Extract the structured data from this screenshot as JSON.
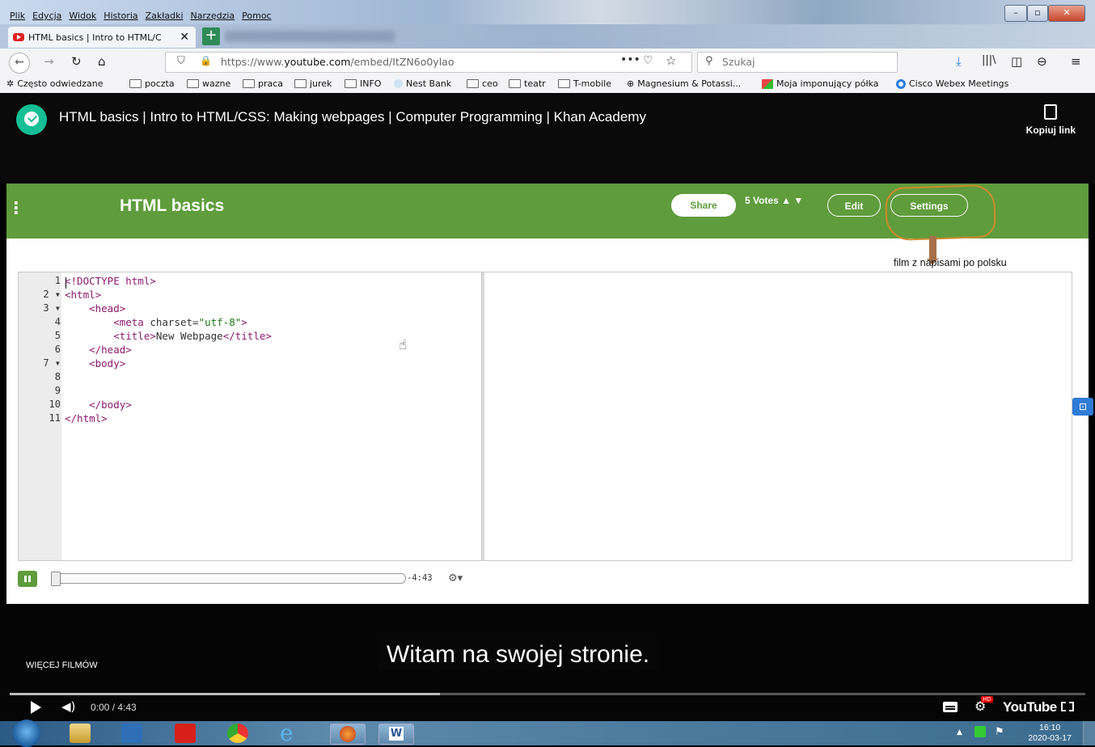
{
  "browser": {
    "menu": [
      "Plik",
      "Edycja",
      "Widok",
      "Historia",
      "Zakładki",
      "Narzędzia",
      "Pomoc"
    ],
    "tab_title": "HTML basics | Intro to HTML/C",
    "url_prefix": "https://www.",
    "url_domain": "youtube.com",
    "url_path": "/embed/ItZN6o0ylao",
    "search_placeholder": "Szukaj",
    "bookmarks": [
      "Często odwiedzane",
      "poczta",
      "wazne",
      "praca",
      "jurek",
      "INFO",
      "Nest Bank",
      "ceo",
      "teatr",
      "T-mobile",
      "Magnesium & Potassi...",
      "Moja imponujący półka",
      "Cisco Webex Meetings"
    ]
  },
  "video": {
    "title": "HTML basics | Intro to HTML/CSS: Making webpages | Computer Programming | Khan Academy",
    "copy_link": "Kopiuj link",
    "more_videos": "WIĘCEJ FILMÓW",
    "caption": "Witam na swojej stronie.",
    "time": "0:00 / 4:43",
    "youtube_logo": "YouTube"
  },
  "ka": {
    "title": "HTML basics",
    "share": "Share",
    "votes": "5 Votes",
    "edit": "Edit",
    "settings": "Settings",
    "annotation": "film z napisami po polsku",
    "remaining": "-4:43",
    "code_lines": [
      {
        "n": "1",
        "fold": false
      },
      {
        "n": "2",
        "fold": true
      },
      {
        "n": "3",
        "fold": true
      },
      {
        "n": "4",
        "fold": false
      },
      {
        "n": "5",
        "fold": false
      },
      {
        "n": "6",
        "fold": false
      },
      {
        "n": "7",
        "fold": true
      },
      {
        "n": "8",
        "fold": false
      },
      {
        "n": "9",
        "fold": false
      },
      {
        "n": "10",
        "fold": false
      },
      {
        "n": "11",
        "fold": false
      }
    ],
    "code": {
      "l1": "<!DOCTYPE html>",
      "l2": "<html>",
      "l3": "    <head>",
      "l4a": "        <meta ",
      "l4b": "charset=",
      "l4c": "\"utf-8\"",
      "l4d": ">",
      "l5a": "        <title>",
      "l5b": "New Webpage",
      "l5c": "</title>",
      "l6": "    </head>",
      "l7": "    <body>",
      "l10": "    </body>",
      "l11": "</html>"
    }
  },
  "taskbar": {
    "clock_time": "16:10",
    "clock_date": "2020-03-17"
  },
  "colors": {
    "ka_green": "#5f9c3c",
    "annotation_orange": "#d08a2c",
    "youtube_red": "#e02020"
  }
}
